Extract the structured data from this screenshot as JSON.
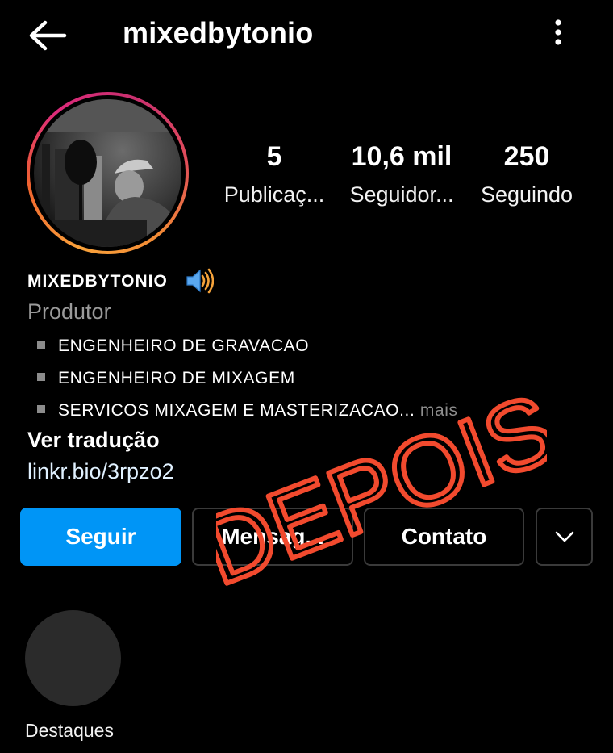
{
  "header": {
    "username": "mixedbytonio",
    "back_icon": "arrow-left-icon",
    "menu_icon": "more-vertical-icon"
  },
  "profile": {
    "display_name": "MIXEDBYTONIO",
    "name_emoji": "speaker-high-volume-icon",
    "category": "Produtor",
    "bio": [
      "ENGENHEIRO DE GRAVACAO",
      "ENGENHEIRO DE MIXAGEM",
      "SERVICOS MIXAGEM E MASTERIZACAO..."
    ],
    "bio_more": " mais",
    "translate_label": "Ver tradução",
    "link": "linkr.bio/3rpzo2"
  },
  "stats": [
    {
      "value": "5",
      "label": "Publicaç..."
    },
    {
      "value": "10,6 mil",
      "label": "Seguidor..."
    },
    {
      "value": "250",
      "label": "Seguindo"
    }
  ],
  "actions": {
    "follow": "Seguir",
    "message": "Mensag...",
    "contact": "Contato",
    "dropdown_icon": "chevron-down-icon"
  },
  "highlights": {
    "label": "Destaques"
  },
  "overlay": {
    "stamp_text": "DEPOIS",
    "stamp_color": "#f24a2e"
  },
  "colors": {
    "background": "#000000",
    "follow_button": "#0095f6",
    "link": "#e0f1ff"
  }
}
